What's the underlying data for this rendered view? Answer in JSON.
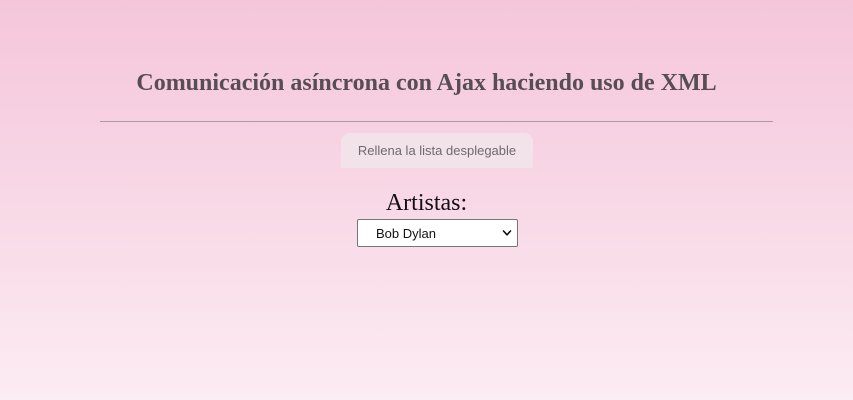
{
  "header": {
    "title": "Comunicación asíncrona con Ajax haciendo uso de XML"
  },
  "controls": {
    "fill_button_label": "Rellena la lista desplegable"
  },
  "artists": {
    "label": "Artistas:",
    "selected": "Bob Dylan"
  },
  "colors": {
    "background_top": "#f5c6da",
    "background_bottom": "#fcecf3",
    "title_text": "#574e53",
    "button_bg": "#f2e3ea"
  },
  "icons": {
    "select_arrow": "chevron-down-icon"
  }
}
